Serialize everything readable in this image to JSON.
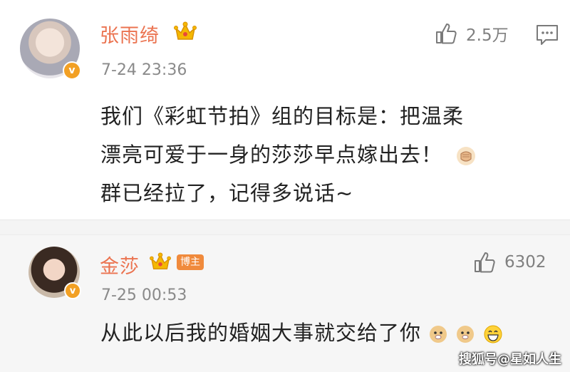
{
  "comments": [
    {
      "author": "张雨绮",
      "time": "7-24 23:36",
      "likes": "2.5万",
      "text_lines": [
        "我们《彩虹节拍》组的目标是：把温柔",
        "漂亮可爱于一身的莎莎早点嫁出去！",
        "群已经拉了，记得多说话~"
      ],
      "badge": "v"
    },
    {
      "author": "金莎",
      "tag": "博主",
      "time": "7-25 00:53",
      "likes": "6302",
      "text": "从此以后我的婚姻大事就交给了你",
      "badge": "v"
    }
  ],
  "watermark": "搜狐号@星如人生",
  "colors": {
    "name": "#eb7350",
    "badge": "#f2a024",
    "tag": "#f08a3c",
    "crown": "#f5b800"
  },
  "icons": [
    "thumb-up-icon",
    "comment-icon",
    "crown-icon",
    "fist-emoji",
    "doge-emoji",
    "laugh-emoji"
  ]
}
